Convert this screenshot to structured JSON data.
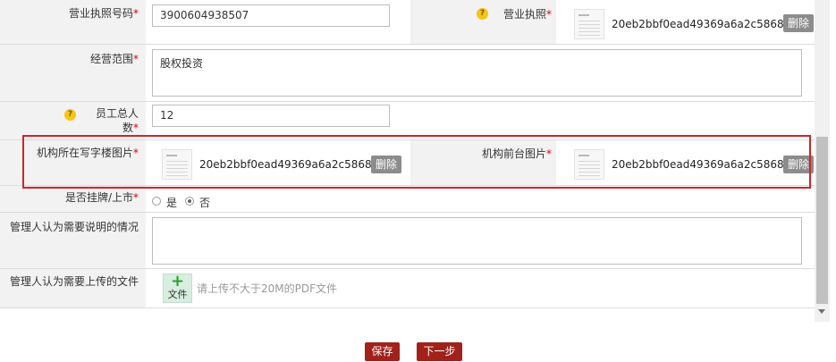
{
  "fields": {
    "license_number": {
      "label": "营业执照号码",
      "value": "3900604938507"
    },
    "license": {
      "label": "营业执照",
      "filename": "20eb2bbf0ead49369a6a2c5868...",
      "delete_label": "删除"
    },
    "business_scope": {
      "label": "经营范围",
      "value": "股权投资"
    },
    "employee_count": {
      "label_line1": "员工总人",
      "label_line2": "数",
      "value": "12"
    },
    "office_photo": {
      "label": "机构所在写字楼图片",
      "filename": "20eb2bbf0ead49369a6a2c5868...",
      "delete_label": "删除"
    },
    "reception_photo": {
      "label": "机构前台图片",
      "filename": "20eb2bbf0ead49369a6a2c5868...",
      "delete_label": "删除"
    },
    "listed": {
      "label": "是否挂牌/上市",
      "options": [
        "是",
        "否"
      ],
      "selected": "否"
    },
    "manager_notes": {
      "label": "管理人认为需要说明的情况",
      "value": ""
    },
    "manager_files": {
      "label": "管理人认为需要上传的文件",
      "upload_label": "文件",
      "hint": "请上传不大于20M的PDF文件"
    }
  },
  "required_mark": "*",
  "help_mark": "?",
  "buttons": {
    "save": "保存",
    "next": "下一步"
  }
}
